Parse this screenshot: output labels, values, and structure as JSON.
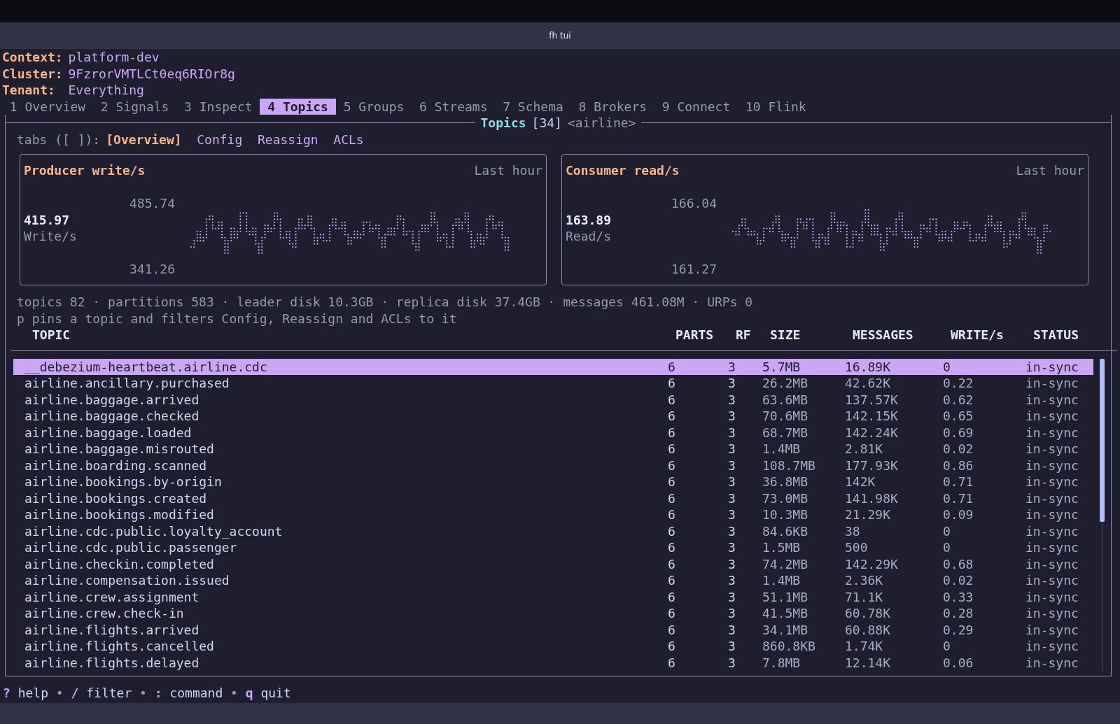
{
  "window": {
    "title": "fh tui"
  },
  "header": [
    {
      "label": "Context:",
      "value": "platform-dev"
    },
    {
      "label": "Cluster:",
      "value": "9FzrorVMTLCt0eq6RIOr8g"
    },
    {
      "label": "Tenant:",
      "value": "Everything"
    }
  ],
  "tabs": [
    {
      "label": "1 Overview",
      "selected": false
    },
    {
      "label": "2 Signals",
      "selected": false
    },
    {
      "label": "3 Inspect",
      "selected": false
    },
    {
      "label": "4 Topics",
      "selected": true
    },
    {
      "label": "5 Groups",
      "selected": false
    },
    {
      "label": "6 Streams",
      "selected": false
    },
    {
      "label": "7 Schema",
      "selected": false
    },
    {
      "label": "8 Brokers",
      "selected": false
    },
    {
      "label": "9 Connect",
      "selected": false
    },
    {
      "label": "10 Flink",
      "selected": false
    }
  ],
  "panel": {
    "title": "Topics",
    "count": "[34]",
    "filter": "<airline>"
  },
  "subtabs": {
    "label": "tabs ([ ]):",
    "items": [
      {
        "label": "[Overview]",
        "selected": true
      },
      {
        "label": "Config",
        "selected": false
      },
      {
        "label": "Reassign",
        "selected": false
      },
      {
        "label": "ACLs",
        "selected": false
      }
    ]
  },
  "charts": [
    {
      "title": "Producer write/s",
      "range": "Last hour",
      "current": "415.97",
      "unit": "Write/s",
      "max": "485.74",
      "min": "341.26"
    },
    {
      "title": "Consumer read/s",
      "range": "Last hour",
      "current": "163.89",
      "unit": "Read/s",
      "max": "166.04",
      "min": "161.27"
    }
  ],
  "stats": "topics 82 · partitions 583 · leader disk 10.3GB · replica disk 37.4GB · messages 461.08M · URPs 0",
  "hint": "p pins a topic and filters Config, Reassign and ACLs to it",
  "table": {
    "columns": [
      "TOPIC",
      "PARTS",
      "RF",
      "SIZE",
      "MESSAGES",
      "WRITE/s",
      "STATUS"
    ],
    "rows": [
      {
        "selected": true,
        "cells": [
          "__debezium-heartbeat.airline.cdc",
          "6",
          "3",
          "5.7MB",
          "16.89K",
          "0",
          "in-sync"
        ]
      },
      {
        "selected": false,
        "cells": [
          "airline.ancillary.purchased",
          "6",
          "3",
          "26.2MB",
          "42.62K",
          "0.22",
          "in-sync"
        ]
      },
      {
        "selected": false,
        "cells": [
          "airline.baggage.arrived",
          "6",
          "3",
          "63.6MB",
          "137.57K",
          "0.62",
          "in-sync"
        ]
      },
      {
        "selected": false,
        "cells": [
          "airline.baggage.checked",
          "6",
          "3",
          "70.6MB",
          "142.15K",
          "0.65",
          "in-sync"
        ]
      },
      {
        "selected": false,
        "cells": [
          "airline.baggage.loaded",
          "6",
          "3",
          "68.7MB",
          "142.24K",
          "0.69",
          "in-sync"
        ]
      },
      {
        "selected": false,
        "cells": [
          "airline.baggage.misrouted",
          "6",
          "3",
          "1.4MB",
          "2.81K",
          "0.02",
          "in-sync"
        ]
      },
      {
        "selected": false,
        "cells": [
          "airline.boarding.scanned",
          "6",
          "3",
          "108.7MB",
          "177.93K",
          "0.86",
          "in-sync"
        ]
      },
      {
        "selected": false,
        "cells": [
          "airline.bookings.by-origin",
          "6",
          "3",
          "36.8MB",
          "142K",
          "0.71",
          "in-sync"
        ]
      },
      {
        "selected": false,
        "cells": [
          "airline.bookings.created",
          "6",
          "3",
          "73.0MB",
          "141.98K",
          "0.71",
          "in-sync"
        ]
      },
      {
        "selected": false,
        "cells": [
          "airline.bookings.modified",
          "6",
          "3",
          "10.3MB",
          "21.29K",
          "0.09",
          "in-sync"
        ]
      },
      {
        "selected": false,
        "cells": [
          "airline.cdc.public.loyalty_account",
          "6",
          "3",
          "84.6KB",
          "38",
          "0",
          "in-sync"
        ]
      },
      {
        "selected": false,
        "cells": [
          "airline.cdc.public.passenger",
          "6",
          "3",
          "1.5MB",
          "500",
          "0",
          "in-sync"
        ]
      },
      {
        "selected": false,
        "cells": [
          "airline.checkin.completed",
          "6",
          "3",
          "74.2MB",
          "142.29K",
          "0.68",
          "in-sync"
        ]
      },
      {
        "selected": false,
        "cells": [
          "airline.compensation.issued",
          "6",
          "3",
          "1.4MB",
          "2.36K",
          "0.02",
          "in-sync"
        ]
      },
      {
        "selected": false,
        "cells": [
          "airline.crew.assignment",
          "6",
          "3",
          "51.1MB",
          "71.1K",
          "0.33",
          "in-sync"
        ]
      },
      {
        "selected": false,
        "cells": [
          "airline.crew.check-in",
          "6",
          "3",
          "41.5MB",
          "60.78K",
          "0.28",
          "in-sync"
        ]
      },
      {
        "selected": false,
        "cells": [
          "airline.flights.arrived",
          "6",
          "3",
          "34.1MB",
          "60.88K",
          "0.29",
          "in-sync"
        ]
      },
      {
        "selected": false,
        "cells": [
          "airline.flights.cancelled",
          "6",
          "3",
          "860.8KB",
          "1.74K",
          "0",
          "in-sync"
        ]
      },
      {
        "selected": false,
        "cells": [
          "airline.flights.delayed",
          "6",
          "3",
          "7.8MB",
          "12.14K",
          "0.06",
          "in-sync"
        ]
      }
    ]
  },
  "footer": {
    "separator": "•",
    "items": [
      {
        "key": "?",
        "label": "help"
      },
      {
        "key": "/",
        "label": "filter"
      },
      {
        "key": ":",
        "label": "command"
      },
      {
        "key": "q",
        "label": "quit"
      }
    ]
  }
}
